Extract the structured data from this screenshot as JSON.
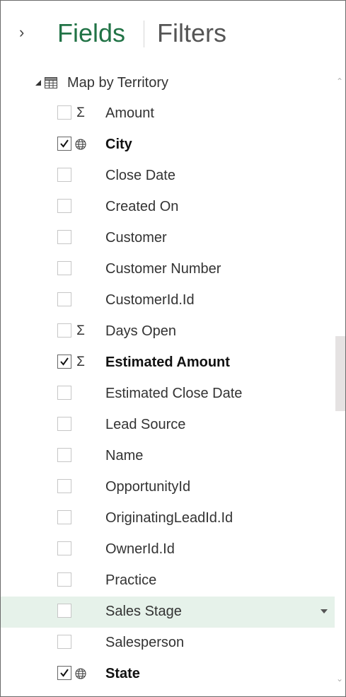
{
  "header": {
    "expand_icon": "chevron-right-icon",
    "tabs": [
      {
        "label": "Fields",
        "active": true
      },
      {
        "label": "Filters",
        "active": false
      }
    ]
  },
  "table": {
    "name": "Map by Territory",
    "icon": "table-icon",
    "expanded": true
  },
  "fields": [
    {
      "label": "Amount",
      "checked": false,
      "type_icon": "sigma-icon"
    },
    {
      "label": "City",
      "checked": true,
      "type_icon": "globe-icon"
    },
    {
      "label": "Close Date",
      "checked": false,
      "type_icon": ""
    },
    {
      "label": "Created On",
      "checked": false,
      "type_icon": ""
    },
    {
      "label": "Customer",
      "checked": false,
      "type_icon": ""
    },
    {
      "label": "Customer Number",
      "checked": false,
      "type_icon": ""
    },
    {
      "label": "CustomerId.Id",
      "checked": false,
      "type_icon": ""
    },
    {
      "label": "Days Open",
      "checked": false,
      "type_icon": "sigma-icon"
    },
    {
      "label": "Estimated Amount",
      "checked": true,
      "type_icon": "sigma-icon"
    },
    {
      "label": "Estimated Close Date",
      "checked": false,
      "type_icon": ""
    },
    {
      "label": "Lead Source",
      "checked": false,
      "type_icon": ""
    },
    {
      "label": "Name",
      "checked": false,
      "type_icon": ""
    },
    {
      "label": "OpportunityId",
      "checked": false,
      "type_icon": ""
    },
    {
      "label": "OriginatingLeadId.Id",
      "checked": false,
      "type_icon": ""
    },
    {
      "label": "OwnerId.Id",
      "checked": false,
      "type_icon": ""
    },
    {
      "label": "Practice",
      "checked": false,
      "type_icon": ""
    },
    {
      "label": "Sales Stage",
      "checked": false,
      "type_icon": "",
      "hovered": true
    },
    {
      "label": "Salesperson",
      "checked": false,
      "type_icon": ""
    },
    {
      "label": "State",
      "checked": true,
      "type_icon": "globe-icon"
    }
  ],
  "colors": {
    "accent": "#217346",
    "hover_row": "#e6f2ea",
    "scroll_thumb": "#e5e2e2"
  }
}
